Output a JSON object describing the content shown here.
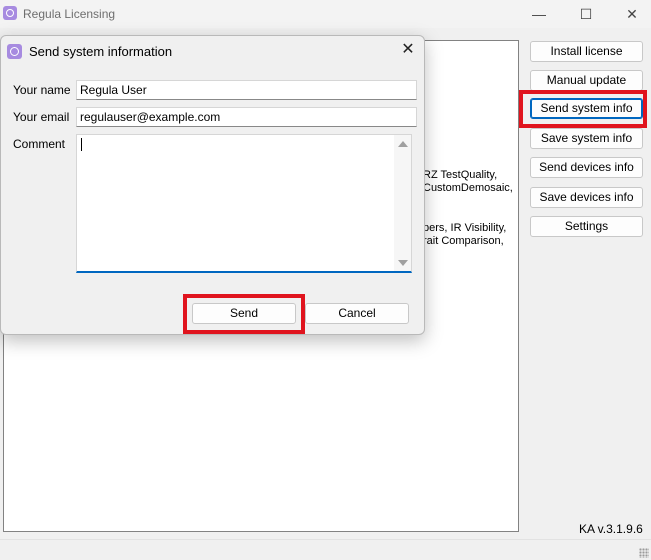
{
  "window": {
    "title": "Regula Licensing",
    "controls": {
      "minimize": "—",
      "maximize": "☐",
      "close": "✕"
    }
  },
  "sidebar": {
    "buttons": [
      {
        "label": "Install license"
      },
      {
        "label": "Manual update"
      },
      {
        "label": "Send system info"
      },
      {
        "label": "Save system info"
      },
      {
        "label": "Send devices info"
      },
      {
        "label": "Save devices info"
      },
      {
        "label": "Settings"
      }
    ]
  },
  "content": {
    "partial_lines": [
      "RZ TestQuality,",
      "CustomDemosaic,",
      "pers, IR Visibility,",
      "rait Comparison,"
    ]
  },
  "status": {
    "version": "KA v.3.1.9.6"
  },
  "dialog": {
    "title": "Send system information",
    "close_glyph": "✕",
    "name_label": "Your name",
    "name_value": "Regula User",
    "email_label": "Your email",
    "email_value": "regulauser@example.com",
    "comment_label": "Comment",
    "comment_value": "",
    "send_label": "Send",
    "cancel_label": "Cancel"
  },
  "colors": {
    "highlight": "#e0141e",
    "accent": "#0067c0",
    "brand": "#a78be0"
  }
}
